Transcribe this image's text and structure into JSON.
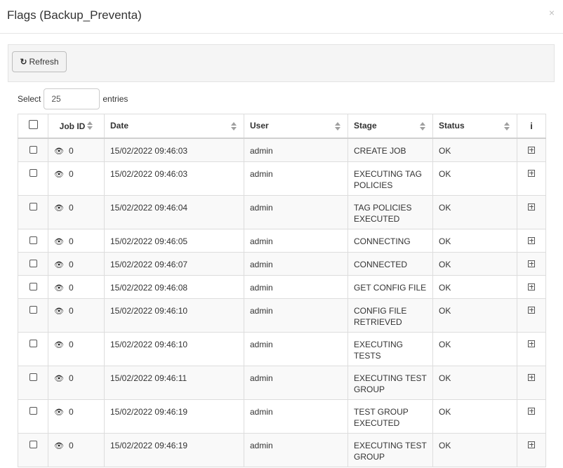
{
  "modal": {
    "title": "Flags (Backup_Preventa)",
    "close": "×"
  },
  "toolbar": {
    "refresh_label": "Refresh"
  },
  "entries": {
    "prefix": "Select",
    "value": "25",
    "suffix": "entries"
  },
  "table": {
    "columns": [
      "Job ID",
      "Date",
      "User",
      "Stage",
      "Status",
      "i"
    ],
    "rows": [
      {
        "job_id": "0",
        "date": "15/02/2022 09:46:03",
        "user": "admin",
        "stage": "CREATE JOB",
        "status": "OK"
      },
      {
        "job_id": "0",
        "date": "15/02/2022 09:46:03",
        "user": "admin",
        "stage": "EXECUTING TAG POLICIES",
        "status": "OK"
      },
      {
        "job_id": "0",
        "date": "15/02/2022 09:46:04",
        "user": "admin",
        "stage": "TAG POLICIES EXECUTED",
        "status": "OK"
      },
      {
        "job_id": "0",
        "date": "15/02/2022 09:46:05",
        "user": "admin",
        "stage": "CONNECTING",
        "status": "OK"
      },
      {
        "job_id": "0",
        "date": "15/02/2022 09:46:07",
        "user": "admin",
        "stage": "CONNECTED",
        "status": "OK"
      },
      {
        "job_id": "0",
        "date": "15/02/2022 09:46:08",
        "user": "admin",
        "stage": "GET CONFIG FILE",
        "status": "OK"
      },
      {
        "job_id": "0",
        "date": "15/02/2022 09:46:10",
        "user": "admin",
        "stage": "CONFIG FILE RETRIEVED",
        "status": "OK"
      },
      {
        "job_id": "0",
        "date": "15/02/2022 09:46:10",
        "user": "admin",
        "stage": "EXECUTING TESTS",
        "status": "OK"
      },
      {
        "job_id": "0",
        "date": "15/02/2022 09:46:11",
        "user": "admin",
        "stage": "EXECUTING TEST GROUP",
        "status": "OK"
      },
      {
        "job_id": "0",
        "date": "15/02/2022 09:46:19",
        "user": "admin",
        "stage": "TEST GROUP EXECUTED",
        "status": "OK"
      },
      {
        "job_id": "0",
        "date": "15/02/2022 09:46:19",
        "user": "admin",
        "stage": "EXECUTING TEST GROUP",
        "status": "OK"
      }
    ]
  },
  "icons": {
    "refresh": "refresh-icon",
    "view": "eye-icon",
    "expand": "plus-square-icon",
    "info": "info-icon",
    "sort": "sort-icon"
  }
}
